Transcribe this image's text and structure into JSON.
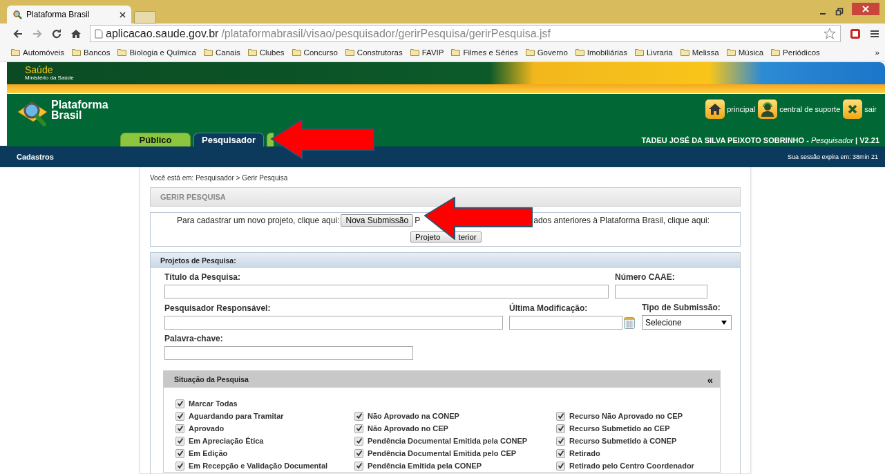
{
  "browser": {
    "tab_title": "Plataforma Brasil",
    "url_host": "aplicacao.saude.gov.br",
    "url_path": "/plataformabrasil/visao/pesquisador/gerirPesquisa/gerirPesquisa.jsf",
    "bookmarks": [
      "Automóveis",
      "Bancos",
      "Biologia e Química",
      "Canais",
      "Clubes",
      "Concurso",
      "Construtoras",
      "FAVIP",
      "Filmes e Séries",
      "Governo",
      "Imobiliárias",
      "Livraria",
      "Melissa",
      "Música",
      "Periódicos"
    ],
    "more": "»"
  },
  "header": {
    "brand": "Saúde",
    "ministry": "Ministério da Saúde",
    "logo_line1": "Plataforma",
    "logo_line2": "Brasil",
    "links": [
      {
        "kind": "home",
        "label": "principal"
      },
      {
        "kind": "support",
        "label": "central de suporte"
      },
      {
        "kind": "exit",
        "label": "sair"
      }
    ],
    "tabs": [
      {
        "label": "Público",
        "selected": false
      },
      {
        "label": "Pesquisador",
        "selected": true
      },
      {
        "selected": false
      }
    ],
    "user_line": "TADEU JOSÉ DA SILVA PEIXOTO SOBRINHO - *Pesquisador* | V2.21"
  },
  "nav": {
    "menu": "Cadastros",
    "session": "Sua sessão expira em: 38min 21"
  },
  "breadcrumb": "Você está em: Pesquisador > Gerir Pesquisa",
  "page_title": "GERIR PESQUISA",
  "notice": {
    "text_start": "Para cadastrar um novo projeto, clique aqui:",
    "new_button": "Nova Submissão",
    "text_mid": "P",
    "text_end": "ados anteriores à Plataforma Brasil, clique aqui:",
    "old_button_start": "Projeto",
    "old_button_end": "terior"
  },
  "projects": {
    "title": "Projetos de Pesquisa:",
    "fields": {
      "title": "Título da Pesquisa:",
      "caae": "Número CAAE:",
      "researcher": "Pesquisador Responsável:",
      "modified": "Última Modificação:",
      "type": "Tipo de Submissão:",
      "type_value": "Selecione",
      "keyword": "Palavra-chave:"
    }
  },
  "status": {
    "title": "Situação da Pesquisa",
    "collapse": "«",
    "check_all": {
      "label": "Marcar Todas",
      "checked": true
    },
    "columns": [
      [
        {
          "label": "Aguardando para Tramitar",
          "checked": true
        },
        {
          "label": "Aprovado",
          "checked": true
        },
        {
          "label": "Em Apreciação Ética",
          "checked": true
        },
        {
          "label": "Em Edição",
          "checked": true
        },
        {
          "label": "Em Recepção e Validação Documental",
          "checked": true
        }
      ],
      [
        {
          "label": "Não Aprovado na CONEP",
          "checked": true
        },
        {
          "label": "Não Aprovado no CEP",
          "checked": true
        },
        {
          "label": "Pendência Documental Emitida pela CONEP",
          "checked": true
        },
        {
          "label": "Pendência Documental Emitida pelo CEP",
          "checked": true
        },
        {
          "label": "Pendência Emitida pela CONEP",
          "checked": true
        }
      ],
      [
        {
          "label": "Recurso Não Aprovado no CEP",
          "checked": true
        },
        {
          "label": "Recurso Submetido ao CEP",
          "checked": true
        },
        {
          "label": "Recurso Submetido à CONEP",
          "checked": true
        },
        {
          "label": "Retirado",
          "checked": true
        },
        {
          "label": "Retirado pelo Centro Coordenador",
          "checked": true
        }
      ]
    ]
  }
}
